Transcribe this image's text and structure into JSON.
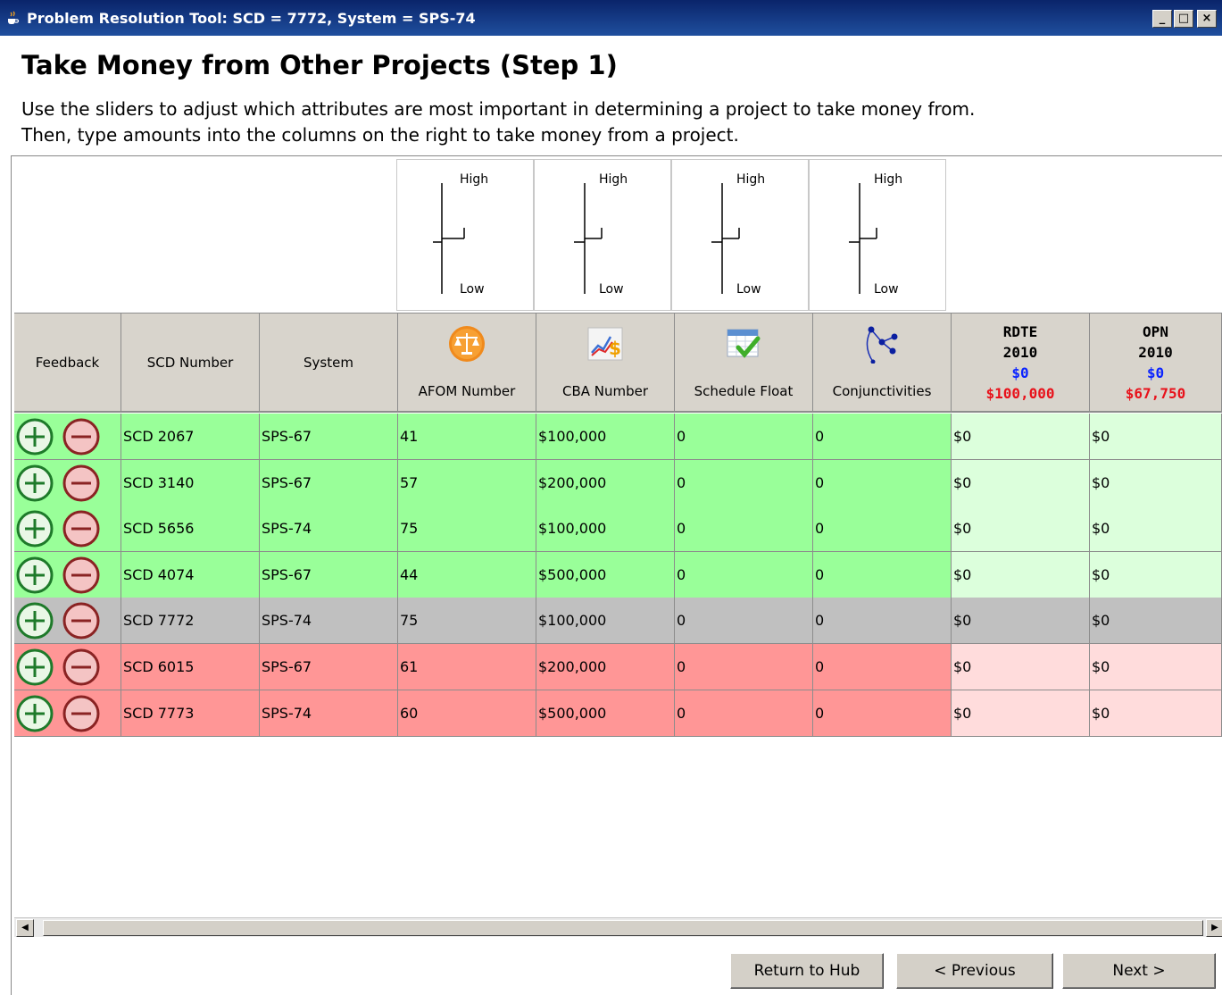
{
  "window": {
    "title": "Problem Resolution Tool: SCD = 7772, System = SPS-74",
    "minimize": "_",
    "maximize": "□",
    "close": "×"
  },
  "page": {
    "heading": "Take Money from Other Projects (Step 1)",
    "instruction_line1": "Use the sliders to adjust which attributes are most important in determining a project to take money from.",
    "instruction_line2": "Then, type amounts into the columns on the right to take money from a project."
  },
  "sliders": [
    {
      "high": "High",
      "low": "Low",
      "level": 0.5
    },
    {
      "high": "High",
      "low": "Low",
      "level": 0.5
    },
    {
      "high": "High",
      "low": "Low",
      "level": 0.5
    },
    {
      "high": "High",
      "low": "Low",
      "level": 0.5
    }
  ],
  "columns": {
    "feedback": "Feedback",
    "scd": "SCD Number",
    "system": "System",
    "afom": {
      "label": "AFOM Number",
      "icon": "scales-icon"
    },
    "cba": {
      "label": "CBA Number",
      "icon": "chart-dollar-icon"
    },
    "float": {
      "label": "Schedule Float",
      "icon": "calendar-check-icon"
    },
    "conj": {
      "label": "Conjunctivities",
      "icon": "network-icon"
    },
    "rdte": {
      "line1": "RDTE",
      "line2": "2010",
      "taken": "$0",
      "needed": "$100,000"
    },
    "opn": {
      "line1": "OPN",
      "line2": "2010",
      "taken": "$0",
      "needed": "$67,750"
    }
  },
  "rows": [
    {
      "status": "green",
      "scd": "SCD 2067",
      "system": "SPS-67",
      "afom": "41",
      "cba": "$100,000",
      "float": "0",
      "conj": "0",
      "rdte": "$0",
      "opn": "$0"
    },
    {
      "status": "green",
      "scd": "SCD 3140",
      "system": "SPS-67",
      "afom": "57",
      "cba": "$200,000",
      "float": "0",
      "conj": "0",
      "rdte": "$0",
      "opn": "$0"
    },
    {
      "status": "green",
      "scd": "SCD 5656",
      "system": "SPS-74",
      "afom": "75",
      "cba": "$100,000",
      "float": "0",
      "conj": "0",
      "rdte": "$0",
      "opn": "$0"
    },
    {
      "status": "green",
      "scd": "SCD 4074",
      "system": "SPS-67",
      "afom": "44",
      "cba": "$500,000",
      "float": "0",
      "conj": "0",
      "rdte": "$0",
      "opn": "$0"
    },
    {
      "status": "gray",
      "scd": "SCD 7772",
      "system": "SPS-74",
      "afom": "75",
      "cba": "$100,000",
      "float": "0",
      "conj": "0",
      "rdte": "$0",
      "opn": "$0"
    },
    {
      "status": "red",
      "scd": "SCD 6015",
      "system": "SPS-67",
      "afom": "61",
      "cba": "$200,000",
      "float": "0",
      "conj": "0",
      "rdte": "$0",
      "opn": "$0"
    },
    {
      "status": "red",
      "scd": "SCD 7773",
      "system": "SPS-74",
      "afom": "60",
      "cba": "$500,000",
      "float": "0",
      "conj": "0",
      "rdte": "$0",
      "opn": "$0"
    }
  ],
  "colors": {
    "green": "#99ff99",
    "green_light": "#dcffdc",
    "gray": "#c0c0c0",
    "red": "#ff9696",
    "red_light": "#ffdcdc"
  },
  "footer": {
    "return_hub": "Return to Hub",
    "previous": "< Previous",
    "next": "Next >"
  }
}
